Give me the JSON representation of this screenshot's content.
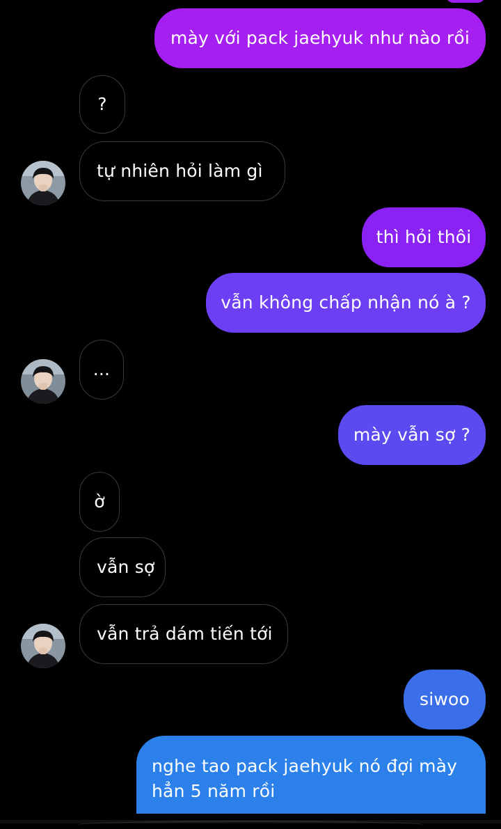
{
  "colors": {
    "background": "#000000",
    "received_border": "#3b3b3b",
    "sent_gradient": [
      "#a51ff0",
      "#8a22f4",
      "#6d3ff2",
      "#5a4af0",
      "#3b6ee9",
      "#2b80ea"
    ]
  },
  "messages": [
    {
      "id": "m1",
      "sender": "me",
      "text": "mày với pack jaehyuk như nào rồi"
    },
    {
      "id": "m2",
      "sender": "them",
      "text": "?"
    },
    {
      "id": "m3",
      "sender": "them",
      "text": "tự nhiên hỏi làm gì"
    },
    {
      "id": "m4",
      "sender": "me",
      "text": "thì hỏi thôi"
    },
    {
      "id": "m5",
      "sender": "me",
      "text": "vẫn không chấp nhận nó à ?"
    },
    {
      "id": "m6",
      "sender": "them",
      "text": "..."
    },
    {
      "id": "m7",
      "sender": "me",
      "text": "mày vẫn sợ ?"
    },
    {
      "id": "m8",
      "sender": "them",
      "text": "ờ"
    },
    {
      "id": "m9",
      "sender": "them",
      "text": "vẫn sợ"
    },
    {
      "id": "m10",
      "sender": "them",
      "text": "vẫn trả dám tiến tới"
    },
    {
      "id": "m11",
      "sender": "me",
      "text": "siwoo"
    },
    {
      "id": "m12",
      "sender": "me",
      "text_line1": "nghe tao pack jaehyuk nó đợi mày",
      "text_line2": "hẳn 5 năm rồi"
    }
  ],
  "avatars": [
    {
      "icon": "contact-avatar-icon"
    },
    {
      "icon": "contact-avatar-icon"
    },
    {
      "icon": "contact-avatar-icon"
    }
  ]
}
